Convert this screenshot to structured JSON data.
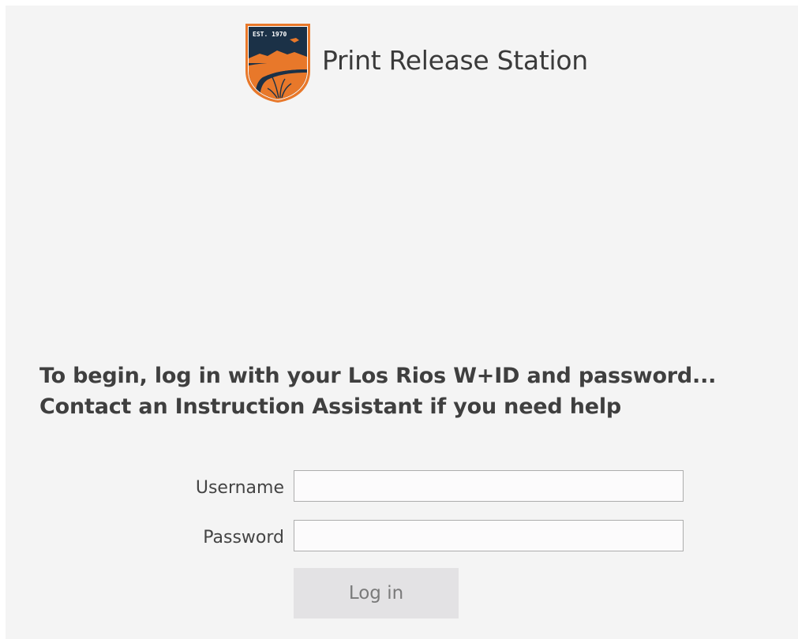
{
  "header": {
    "logo_text": "EST. 1970",
    "title": "Print Release Station"
  },
  "instructions": {
    "line1": "To begin, log in with your Los Rios W+ID and password...",
    "line2": "Contact an Instruction Assistant if you need help"
  },
  "form": {
    "username_label": "Username",
    "username_value": "",
    "password_label": "Password",
    "password_value": "",
    "login_label": "Log in"
  },
  "colors": {
    "background": "#f4f4f4",
    "logo_orange": "#e8782a",
    "logo_navy": "#1b3147",
    "button_bg": "#e3e2e4"
  }
}
